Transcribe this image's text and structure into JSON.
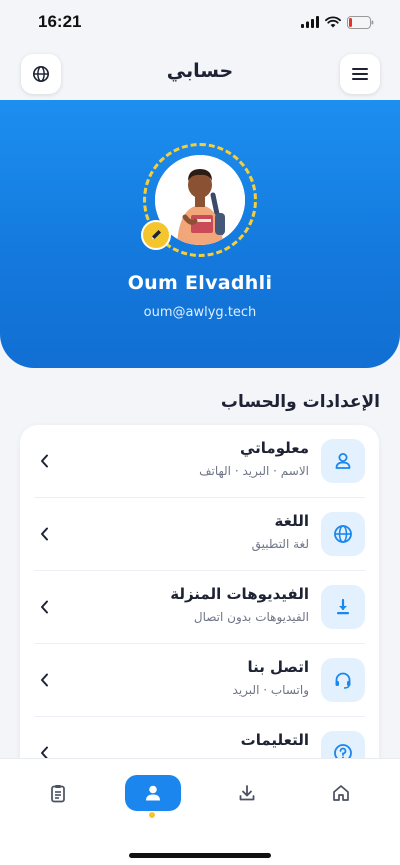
{
  "status_bar": {
    "time": "16:21"
  },
  "header": {
    "title": "حسابي"
  },
  "profile": {
    "name": "Oum Elvadhli",
    "email": "oum@awlyg.tech"
  },
  "section": {
    "title": "الإعدادات والحساب"
  },
  "menu": {
    "items": [
      {
        "title": "معلوماتي",
        "subtitle": "الاسم · البريد · الهاتف",
        "icon": "user-icon"
      },
      {
        "title": "اللغة",
        "subtitle": "لغة التطبيق",
        "icon": "globe-icon"
      },
      {
        "title": "الفيديوهات المنزلة",
        "subtitle": "الفيديوهات بدون اتصال",
        "icon": "download-icon"
      },
      {
        "title": "اتصل بنا",
        "subtitle": "واتساب · البريد",
        "icon": "headset-icon"
      },
      {
        "title": "التعليمات",
        "subtitle": "",
        "icon": "help-icon"
      }
    ]
  },
  "bottom_nav": {
    "items": [
      {
        "icon": "clipboard-icon",
        "active": false
      },
      {
        "icon": "profile-icon",
        "active": true
      },
      {
        "icon": "download-icon",
        "active": false
      },
      {
        "icon": "home-icon",
        "active": false
      }
    ]
  },
  "colors": {
    "primary": "#1a86ee",
    "accent": "#f5c62c",
    "icon_bg": "#e3f0fd"
  }
}
